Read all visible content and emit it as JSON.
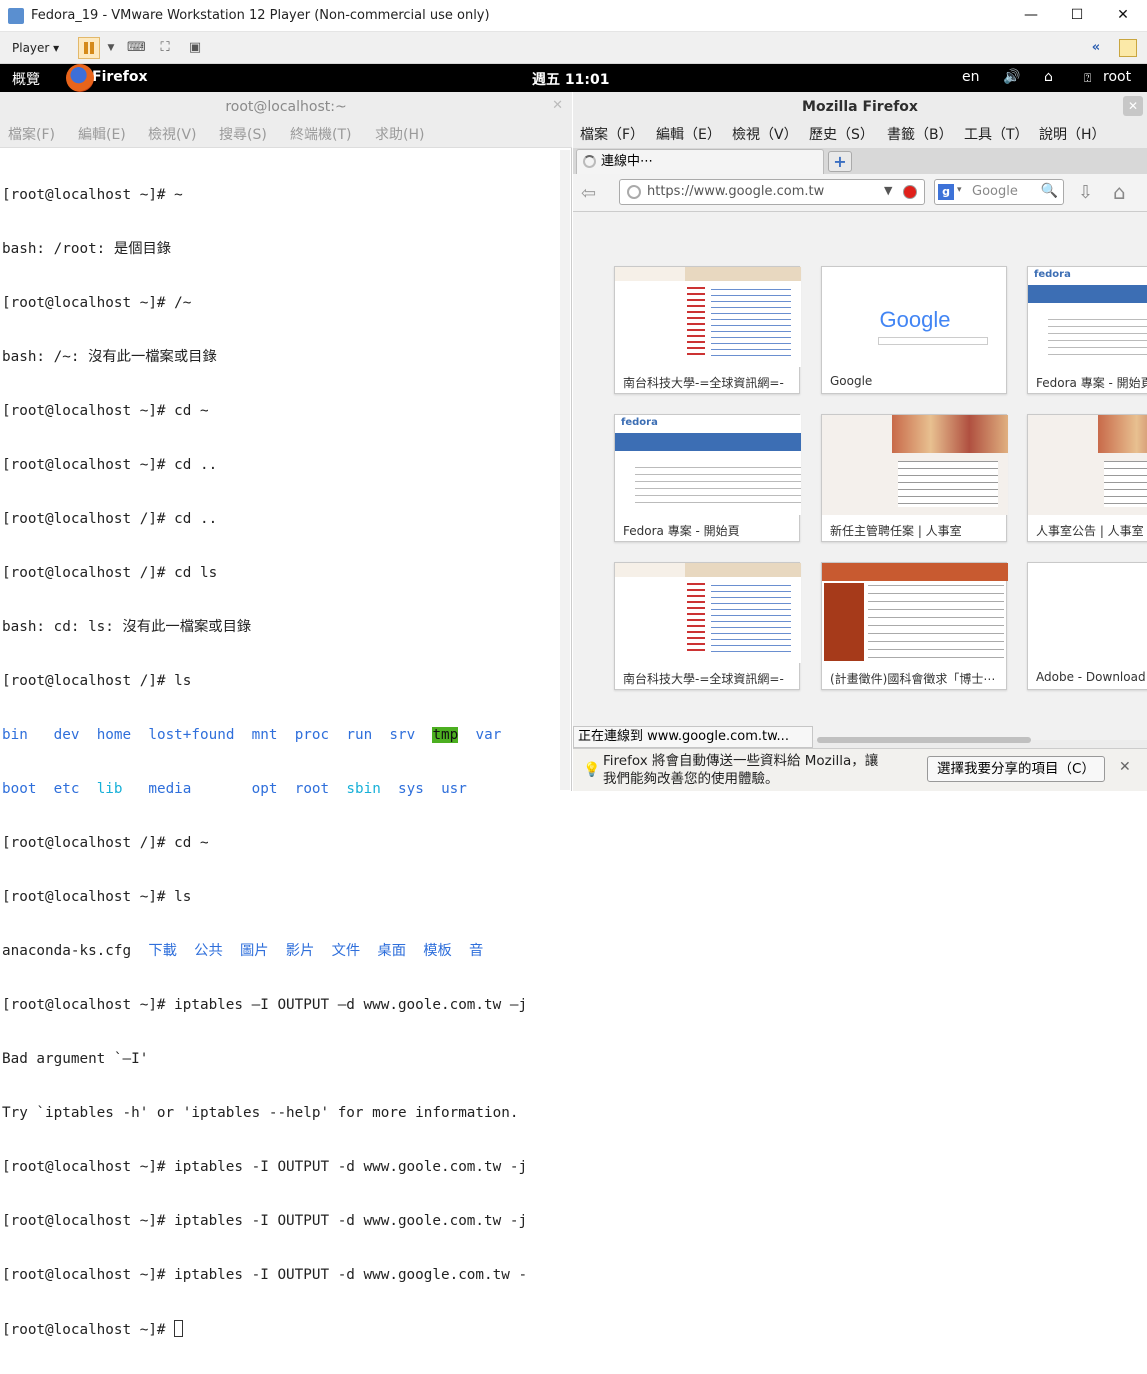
{
  "vm": {
    "title": "Fedora_19 - VMware Workstation 12 Player (Non-commercial use only)",
    "player_menu": "Player ▾",
    "minimize": "—",
    "maximize": "☐",
    "close": "✕",
    "icon_collapse": "«"
  },
  "gnome": {
    "activities": "概覽",
    "app_name": "Firefox",
    "clock": "週五 11:01",
    "lang": "en",
    "volume": "🔊",
    "network": "⌂",
    "user": "root"
  },
  "terminal": {
    "title": "root@localhost:~",
    "menu": [
      "檔案(F)",
      "編輯(E)",
      "檢視(V)",
      "搜尋(S)",
      "終端機(T)",
      "求助(H)"
    ],
    "lines": [
      "[root@localhost ~]# ~",
      "bash: /root: 是個目錄",
      "[root@localhost ~]# /~",
      "bash: /~: 沒有此一檔案或目錄",
      "[root@localhost ~]# cd ~",
      "[root@localhost ~]# cd ..",
      "[root@localhost /]# cd ..",
      "[root@localhost /]# cd ls",
      "bash: cd: ls: 沒有此一檔案或目錄",
      "[root@localhost /]# ls"
    ],
    "ls_row1": [
      "bin",
      "dev",
      "home",
      "lost+found",
      "mnt",
      "proc",
      "run",
      "srv",
      "tmp",
      "var"
    ],
    "ls_row2": [
      "boot",
      "etc",
      "lib",
      "media",
      "opt",
      "root",
      "sbin",
      "sys",
      "usr"
    ],
    "lines2": [
      "[root@localhost /]# cd ~",
      "[root@localhost ~]# ls"
    ],
    "home_file": "anaconda-ks.cfg",
    "home_dirs": [
      "下載",
      "公共",
      "圖片",
      "影片",
      "文件",
      "桌面",
      "模板",
      "音"
    ],
    "lines3": [
      "[root@localhost ~]# iptables —I OUTPUT —d www.goole.com.tw —j",
      "Bad argument `—I'",
      "Try `iptables -h' or 'iptables --help' for more information.",
      "[root@localhost ~]# iptables -I OUTPUT -d www.goole.com.tw -j",
      "[root@localhost ~]# iptables -I OUTPUT -d www.goole.com.tw -j",
      "[root@localhost ~]# iptables -I OUTPUT -d www.google.com.tw -"
    ],
    "prompt": "[root@localhost ~]# "
  },
  "firefox": {
    "title": "Mozilla Firefox",
    "menu": [
      "檔案（F）",
      "編輯（E）",
      "檢視（V）",
      "歷史（S）",
      "書籤（B）",
      "工具（T）",
      "說明（H）"
    ],
    "tab_label": "連線中⋯",
    "url": "https://www.google.com.tw",
    "search_placeholder": "Google",
    "search_engine_letter": "g",
    "tiles": [
      {
        "label": "南台科技大學-=全球資訊網=-",
        "kind": "univ"
      },
      {
        "label": "Google",
        "kind": "google"
      },
      {
        "label": "Fedora 專案 - 開始頁",
        "kind": "fedora"
      },
      {
        "label": "Fedora 專案 - 開始頁",
        "kind": "fedora"
      },
      {
        "label": "新任主管聘任案 | 人事室",
        "kind": "photo"
      },
      {
        "label": "人事室公告 | 人事室",
        "kind": "photo"
      },
      {
        "label": "南台科技大學-=全球資訊網=-",
        "kind": "univ"
      },
      {
        "label": "(計畫徵件)國科會徵求「博士⋯",
        "kind": "red"
      },
      {
        "label": "Adobe - Download A",
        "kind": "blank"
      }
    ],
    "google_logo": "Google",
    "fedora_logo": "fedora",
    "status": "正在連線到 www.google.com.tw...",
    "notify_line1": "Firefox 將會自動傳送一些資料給 Mozilla，讓",
    "notify_line2": "我們能夠改善您的使用體驗。",
    "notify_button": "選擇我要分享的項目（C）",
    "notify_close": "✕"
  }
}
